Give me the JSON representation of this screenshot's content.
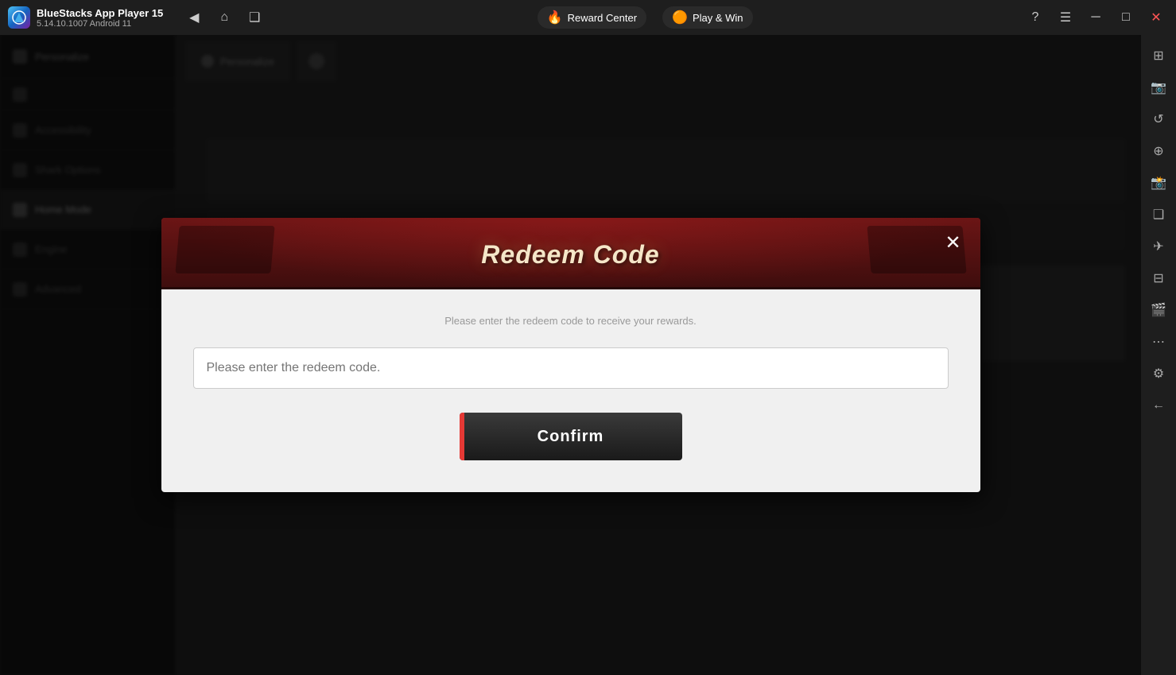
{
  "titlebar": {
    "app_name": "BlueStacks App Player 15",
    "version": "5.14.10.1007  Android 11",
    "reward_center_label": "Reward Center",
    "play_win_label": "Play & Win",
    "nav_back_icon": "◀",
    "nav_home_icon": "⌂",
    "nav_layers_icon": "❑",
    "help_icon": "?",
    "menu_icon": "☰",
    "minimize_icon": "─",
    "maximize_icon": "□",
    "close_icon": "✕",
    "more_icon": "⋯"
  },
  "sidebar": {
    "items": [
      {
        "label": "Personalize",
        "active": false
      },
      {
        "label": "",
        "active": false
      },
      {
        "label": "Accessibility",
        "active": false
      },
      {
        "label": "Shark Options",
        "active": false
      },
      {
        "label": "Home Mode",
        "active": true
      },
      {
        "label": "Engine",
        "active": false
      },
      {
        "label": "Advanced",
        "active": false
      }
    ]
  },
  "right_sidebar": {
    "icons": [
      "⊞",
      "📸",
      "↺",
      "⊕",
      "📸",
      "⊞",
      "✈",
      "⊟",
      "📷",
      "⋯",
      "⚙",
      "←"
    ]
  },
  "modal": {
    "title": "Redeem Code",
    "close_icon": "✕",
    "description": "Please enter the redeem code to receive your rewards.",
    "input_placeholder": "Please enter the redeem code.",
    "confirm_label": "Confirm"
  }
}
